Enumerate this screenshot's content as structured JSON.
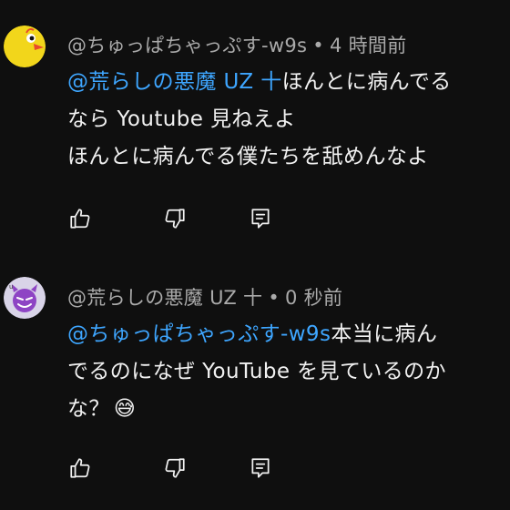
{
  "comments": [
    {
      "author": "@ちゅっぱちゃっぷす-w9s",
      "separator": "•",
      "time": "4 時間前",
      "avatar_icon": "yellow-bird-avatar-icon",
      "mention": "@荒らしの悪魔 UZ 十",
      "line1_rest": "ほんとに病んでる",
      "line2": "なら Youtube 見ねえよ",
      "line3": "ほんとに病んでる僕たちを舐めんなよ",
      "emoji": ""
    },
    {
      "author": "@荒らしの悪魔 UZ 十",
      "separator": "•",
      "time": "0 秒前",
      "avatar_icon": "purple-devil-avatar-icon",
      "mention": "@ちゅっぱちゃっぷす-w9s",
      "line1_rest": "本当に病ん",
      "line2": "でるのになぜ YouTube を見ているのか",
      "line3": "な？",
      "emoji": "😅"
    }
  ],
  "colors": {
    "background": "#0f0f0f",
    "text": "#f1f1f1",
    "meta": "#aaaaaa",
    "mention": "#3ea6ff"
  }
}
